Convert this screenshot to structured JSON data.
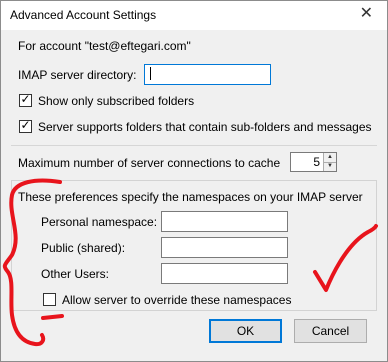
{
  "window": {
    "title": "Advanced Account Settings"
  },
  "account_label": "For account \"test@eftegari.com\"",
  "imap_dir": {
    "label": "IMAP server directory:",
    "value": ""
  },
  "options": {
    "show_subscribed": {
      "label": "Show only subscribed folders",
      "checked": true
    },
    "subfolders": {
      "label": "Server supports folders that contain sub-folders and messages",
      "checked": true
    }
  },
  "max_connections": {
    "label": "Maximum number of server connections to cache",
    "value": "5"
  },
  "namespaces": {
    "heading": "These preferences specify the namespaces on your IMAP server",
    "personal_label": "Personal namespace:",
    "public_label": "Public (shared):",
    "other_label": "Other Users:",
    "personal_value": "",
    "public_value": "",
    "other_value": "",
    "override": {
      "label": "Allow server to override these namespaces",
      "checked": false
    }
  },
  "buttons": {
    "ok": "OK",
    "cancel": "Cancel"
  },
  "annotation_color": "#e8141c"
}
